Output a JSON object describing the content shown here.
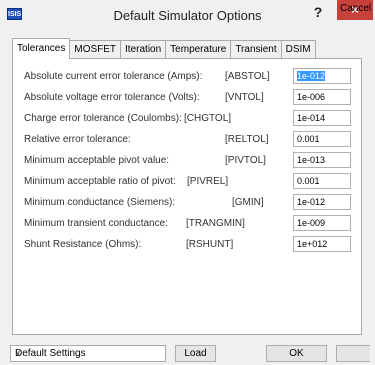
{
  "window": {
    "app_icon_text": "ISIS",
    "title": "Default Simulator Options",
    "help": "?",
    "close": "×"
  },
  "tabs": [
    {
      "label": "Tolerances",
      "active": true
    },
    {
      "label": "MOSFET",
      "active": false
    },
    {
      "label": "Iteration",
      "active": false
    },
    {
      "label": "Temperature",
      "active": false
    },
    {
      "label": "Transient",
      "active": false
    },
    {
      "label": "DSIM",
      "active": false
    }
  ],
  "options": [
    {
      "label": "Absolute current error tolerance (Amps):",
      "code": "[ABSTOL]",
      "value": "1e-012"
    },
    {
      "label": "Absolute voltage error tolerance (Volts):",
      "code": "[VNTOL]",
      "value": "1e-006"
    },
    {
      "label": "Charge error tolerance (Coulombs):",
      "code": "[CHGTOL]",
      "value": "1e-014"
    },
    {
      "label": "Relative error tolerance:",
      "code": "[RELTOL]",
      "value": "0.001"
    },
    {
      "label": "Minimum acceptable pivot value:",
      "code": "[PIVTOL]",
      "value": "1e-013"
    },
    {
      "label": "Minimum acceptable ratio of pivot:",
      "code": "[PIVREL]",
      "value": "0.001"
    },
    {
      "label": "Minimum conductance (Siemens):",
      "code": "[GMIN]",
      "value": "1e-012"
    },
    {
      "label": "Minimum transient conductance:",
      "code": "[TRANGMIN]",
      "value": "1e-009"
    },
    {
      "label": "Shunt Resistance (Ohms):",
      "code": "[RSHUNT]",
      "value": "1e+012"
    }
  ],
  "footer": {
    "preset_value": "Default Settings",
    "load": "Load",
    "ok": "OK",
    "cancel": "Cancel"
  }
}
